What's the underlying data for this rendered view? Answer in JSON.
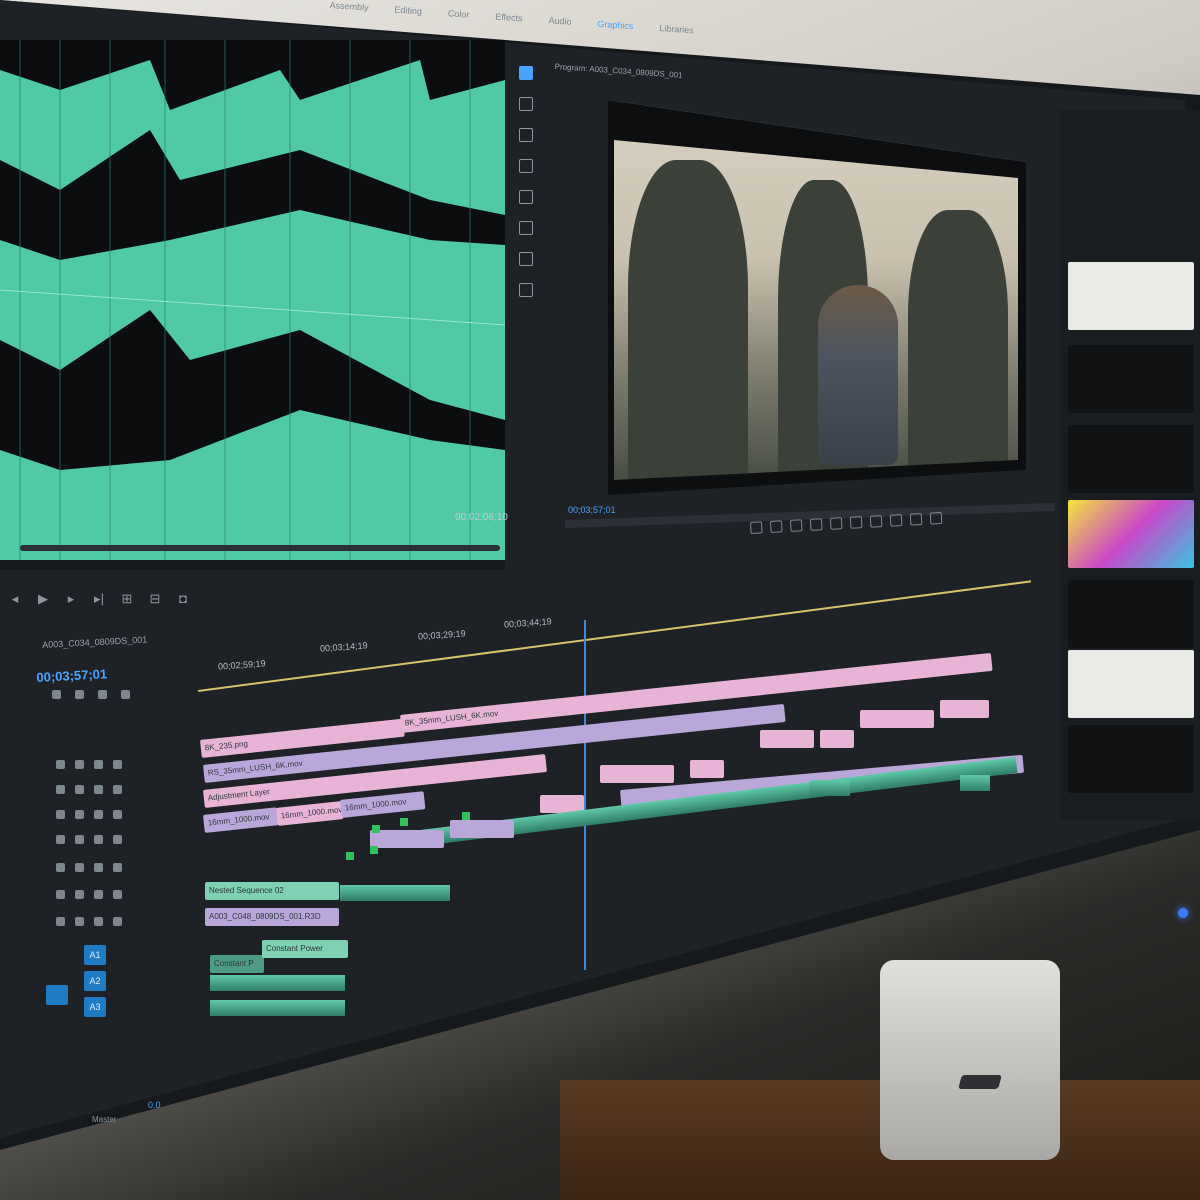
{
  "workspace": {
    "tabs": [
      "Assembly",
      "Editing",
      "Color",
      "Effects",
      "Audio",
      "Graphics",
      "Libraries"
    ],
    "active_tab_index": 5
  },
  "audio_panel": {
    "timecode": "00;02;06;10"
  },
  "program_monitor": {
    "title": "Program: A003_C034_0809DS_001",
    "timecode": "00;03;57;01"
  },
  "timeline": {
    "sequence_name": "A003_C034_0809DS_001",
    "timecode": "00;03;57;01",
    "ruler": [
      "00;02;59;19",
      "00;03;14;19",
      "00;03;29;19",
      "00;03;44;19"
    ],
    "audio_buttons": [
      "A1",
      "A2",
      "A3"
    ],
    "master_label": "Master",
    "master_value": "0.0",
    "clips": {
      "c1": "8K_235.png",
      "c2": "RS_35mm_LUSH_6K.mov",
      "c3": "8K_35mm_LUSH_6K.mov",
      "c4": "Adjustment Layer",
      "c5": "16mm_1000.mov",
      "c6": "16mm_1000.mov",
      "c7": "16mm_1000.mov",
      "c8": "Nested Sequence 02",
      "c9": "A003_C048_0809DS_001.R3D",
      "c10": "Constant Power",
      "c11": "Constant P"
    }
  },
  "colors": {
    "accent": "#4aa3ff",
    "clip_pink": "#e7b4d6",
    "clip_lavender": "#b9a7d9",
    "clip_mint": "#7ed1b3",
    "waveform": "#4fc9a6"
  }
}
